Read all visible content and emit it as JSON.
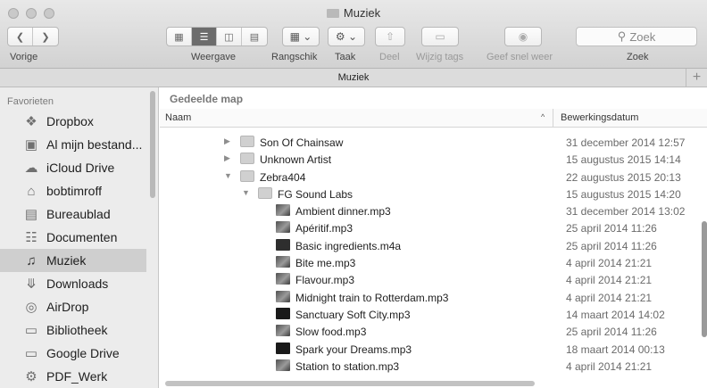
{
  "window": {
    "title": "Muziek"
  },
  "toolbar": {
    "back_label": "Vorige",
    "view_label": "Weergave",
    "arrange_label": "Rangschik",
    "action_label": "Taak",
    "share_label": "Deel",
    "tags_label": "Wijzig tags",
    "quicklook_label": "Geef snel weer",
    "search_label": "Zoek",
    "search_placeholder": "Zoek",
    "icons": [
      "chevron-left-icon",
      "chevron-right-icon",
      "grid-view-icon",
      "list-view-icon",
      "column-view-icon",
      "coverflow-view-icon",
      "arrange-grid-icon",
      "gear-icon",
      "share-icon",
      "tag-icon",
      "eye-icon",
      "search-icon"
    ]
  },
  "pathbar": {
    "label": "Muziek",
    "plus": "+"
  },
  "sidebar": {
    "header": "Favorieten",
    "items": [
      {
        "label": "Dropbox",
        "icon": "dropbox-icon"
      },
      {
        "label": "Al mijn bestand...",
        "icon": "all-files-icon"
      },
      {
        "label": "iCloud Drive",
        "icon": "cloud-icon"
      },
      {
        "label": "bobtimroff",
        "icon": "home-icon"
      },
      {
        "label": "Bureaublad",
        "icon": "desktop-icon"
      },
      {
        "label": "Documenten",
        "icon": "document-icon"
      },
      {
        "label": "Muziek",
        "icon": "music-note-icon",
        "selected": true
      },
      {
        "label": "Downloads",
        "icon": "download-icon"
      },
      {
        "label": "AirDrop",
        "icon": "airdrop-icon"
      },
      {
        "label": "Bibliotheek",
        "icon": "folder-icon"
      },
      {
        "label": "Google Drive",
        "icon": "folder-icon"
      },
      {
        "label": "PDF_Werk",
        "icon": "gear-folder-icon"
      }
    ]
  },
  "content": {
    "section_title": "Gedeelde map",
    "columns": {
      "name": "Naam",
      "date": "Bewerkingsdatum",
      "sort_indicator": "^"
    },
    "rows": [
      {
        "name": "Son Of Chainsaw",
        "date": "31 december 2014 12:57",
        "level": 1,
        "type": "folder",
        "disclosure": "▶"
      },
      {
        "name": "Unknown Artist",
        "date": "15 augustus 2015 14:14",
        "level": 1,
        "type": "folder",
        "disclosure": "▶"
      },
      {
        "name": "Zebra404",
        "date": "22 augustus 2015 20:13",
        "level": 1,
        "type": "folder",
        "disclosure": "▼"
      },
      {
        "name": "FG Sound Labs",
        "date": "15 augustus 2015 14:20",
        "level": 2,
        "type": "folder",
        "disclosure": "▼"
      },
      {
        "name": "Ambient dinner.mp3",
        "date": "31 december 2014 13:02",
        "level": 3,
        "type": "audio",
        "disclosure": ""
      },
      {
        "name": "Apéritif.mp3",
        "date": "25 april 2014 11:26",
        "level": 3,
        "type": "audio",
        "disclosure": ""
      },
      {
        "name": "Basic ingredients.m4a",
        "date": "25 april 2014 11:26",
        "level": 3,
        "type": "m4a",
        "disclosure": ""
      },
      {
        "name": "Bite me.mp3",
        "date": "4 april 2014 21:21",
        "level": 3,
        "type": "audio",
        "disclosure": ""
      },
      {
        "name": "Flavour.mp3",
        "date": "4 april 2014 21:21",
        "level": 3,
        "type": "audio",
        "disclosure": ""
      },
      {
        "name": "Midnight train to Rotterdam.mp3",
        "date": "4 april 2014 21:21",
        "level": 3,
        "type": "audio",
        "disclosure": ""
      },
      {
        "name": "Sanctuary Soft City.mp3",
        "date": "14 maart 2014 14:02",
        "level": 3,
        "type": "dark",
        "disclosure": ""
      },
      {
        "name": "Slow food.mp3",
        "date": "25 april 2014 11:26",
        "level": 3,
        "type": "audio",
        "disclosure": ""
      },
      {
        "name": "Spark your Dreams.mp3",
        "date": "18 maart 2014 00:13",
        "level": 3,
        "type": "dark",
        "disclosure": ""
      },
      {
        "name": "Station to station.mp3",
        "date": "4 april 2014 21:21",
        "level": 3,
        "type": "audio",
        "disclosure": ""
      }
    ]
  }
}
